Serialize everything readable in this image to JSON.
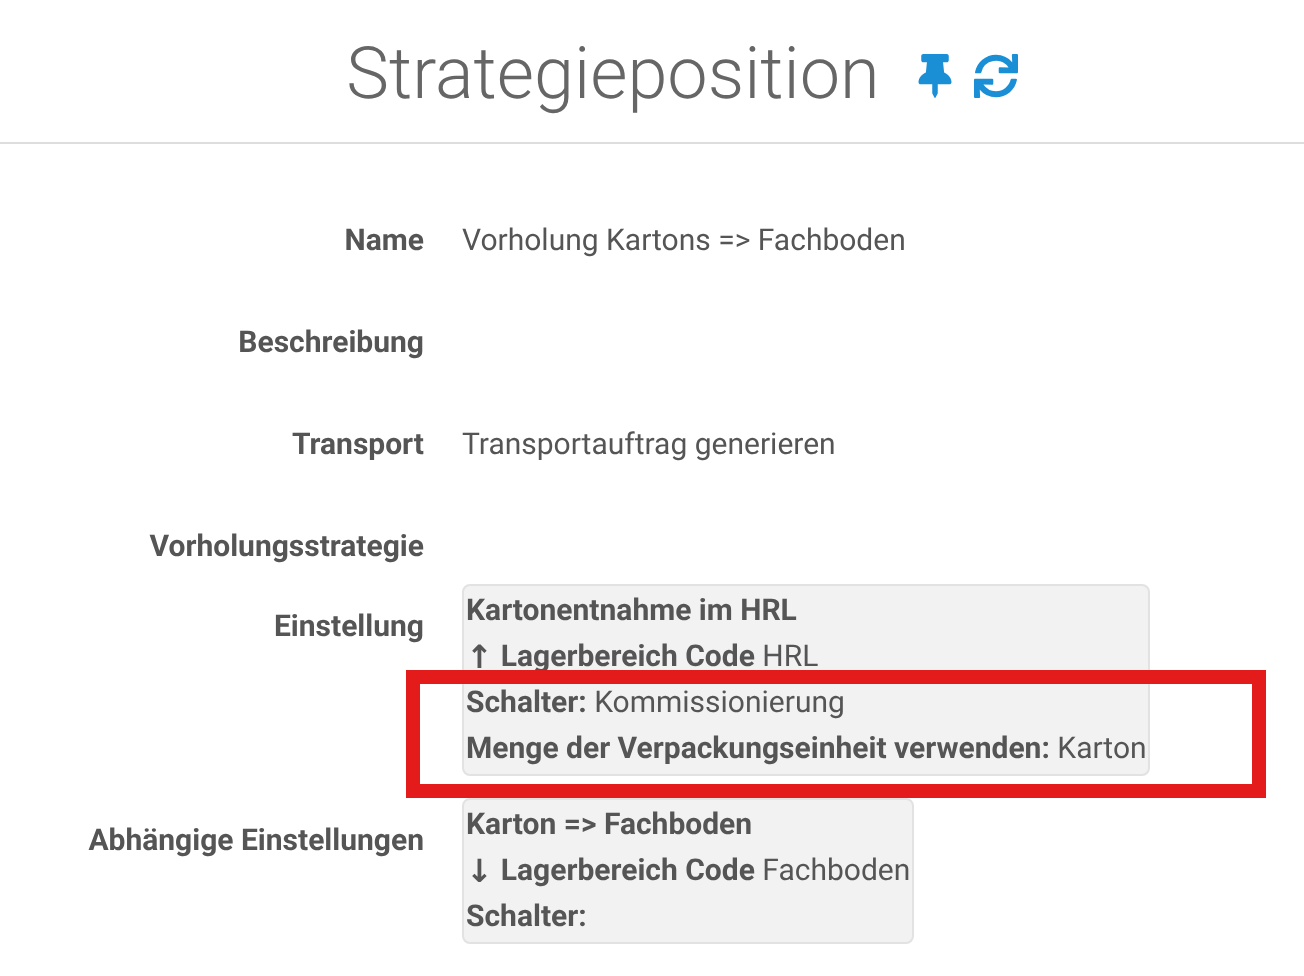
{
  "title": "Strategieposition",
  "fields": [
    {
      "label": "Name",
      "kind": "text",
      "value": "Vorholung Kartons => Fachboden"
    },
    {
      "label": "Beschreibung",
      "kind": "text"
    },
    {
      "label": "Transport",
      "kind": "text",
      "value": "Transportauftrag generieren"
    },
    {
      "label": "Vorholungsstrategie",
      "kind": "text"
    },
    {
      "label": "Einstellung",
      "kind": "card",
      "highlighted": true,
      "lines": [
        {
          "label": "Kartonentnahme im HRL"
        },
        {
          "arrow": "↑",
          "label": "Lagerbereich Code",
          "value": "HRL"
        },
        {
          "label": "Schalter:",
          "value": "Kommissionierung"
        },
        {
          "label": "Menge der Verpackungseinheit verwenden:",
          "value": "Karton"
        }
      ]
    },
    {
      "label": "Abhängige Einstellungen",
      "kind": "card",
      "lines": [
        {
          "label": "Karton => Fachboden"
        },
        {
          "arrow": "↓",
          "label": "Lagerbereich Code",
          "value": "Fachboden"
        },
        {
          "label": "Schalter:"
        }
      ]
    }
  ]
}
